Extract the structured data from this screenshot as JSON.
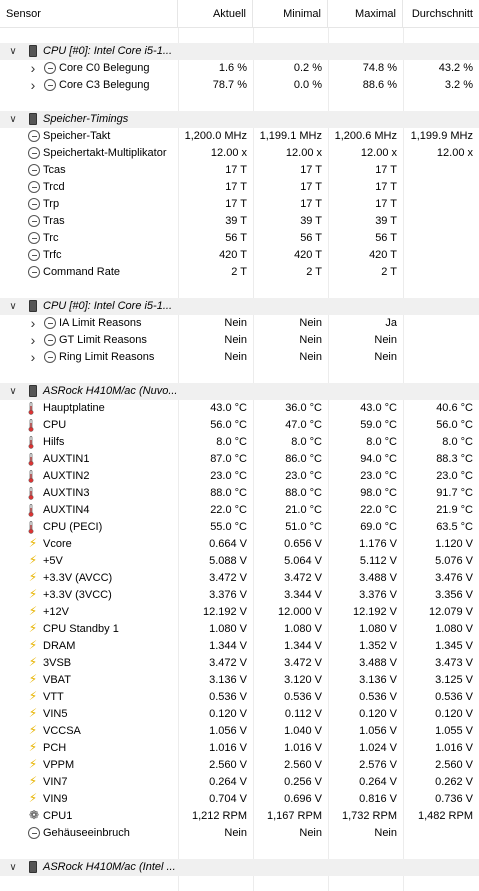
{
  "columns": {
    "sensor": "Sensor",
    "aktuell": "Aktuell",
    "minimal": "Minimal",
    "maximal": "Maximal",
    "durchschnitt": "Durchschnitt"
  },
  "groups": [
    {
      "label": "CPU [#0]: Intel Core i5-1...",
      "rows": [
        {
          "label": "Core C0 Belegung",
          "icon": "clock-icon",
          "expandable": true,
          "aktuell": "1.6 %",
          "minimal": "0.2 %",
          "maximal": "74.8 %",
          "durchschnitt": "43.2 %"
        },
        {
          "label": "Core C3 Belegung",
          "icon": "clock-icon",
          "expandable": true,
          "aktuell": "78.7 %",
          "minimal": "0.0 %",
          "maximal": "88.6 %",
          "durchschnitt": "3.2 %"
        }
      ]
    },
    {
      "label": "Speicher-Timings",
      "rows": [
        {
          "label": "Speicher-Takt",
          "icon": "clock-icon",
          "aktuell": "1,200.0 MHz",
          "minimal": "1,199.1 MHz",
          "maximal": "1,200.6 MHz",
          "durchschnitt": "1,199.9 MHz"
        },
        {
          "label": "Speichertakt-Multiplikator",
          "icon": "clock-icon",
          "aktuell": "12.00 x",
          "minimal": "12.00 x",
          "maximal": "12.00 x",
          "durchschnitt": "12.00 x"
        },
        {
          "label": "Tcas",
          "icon": "clock-icon",
          "aktuell": "17 T",
          "minimal": "17 T",
          "maximal": "17 T",
          "durchschnitt": ""
        },
        {
          "label": "Trcd",
          "icon": "clock-icon",
          "aktuell": "17 T",
          "minimal": "17 T",
          "maximal": "17 T",
          "durchschnitt": ""
        },
        {
          "label": "Trp",
          "icon": "clock-icon",
          "aktuell": "17 T",
          "minimal": "17 T",
          "maximal": "17 T",
          "durchschnitt": ""
        },
        {
          "label": "Tras",
          "icon": "clock-icon",
          "aktuell": "39 T",
          "minimal": "39 T",
          "maximal": "39 T",
          "durchschnitt": ""
        },
        {
          "label": "Trc",
          "icon": "clock-icon",
          "aktuell": "56 T",
          "minimal": "56 T",
          "maximal": "56 T",
          "durchschnitt": ""
        },
        {
          "label": "Trfc",
          "icon": "clock-icon",
          "aktuell": "420 T",
          "minimal": "420 T",
          "maximal": "420 T",
          "durchschnitt": ""
        },
        {
          "label": "Command Rate",
          "icon": "clock-icon",
          "aktuell": "2 T",
          "minimal": "2 T",
          "maximal": "2 T",
          "durchschnitt": ""
        }
      ]
    },
    {
      "label": "CPU [#0]: Intel Core i5-1...",
      "rows": [
        {
          "label": "IA Limit Reasons",
          "icon": "clock-icon",
          "expandable": true,
          "aktuell": "Nein",
          "minimal": "Nein",
          "maximal": "Ja",
          "durchschnitt": ""
        },
        {
          "label": "GT Limit Reasons",
          "icon": "clock-icon",
          "expandable": true,
          "aktuell": "Nein",
          "minimal": "Nein",
          "maximal": "Nein",
          "durchschnitt": ""
        },
        {
          "label": "Ring Limit Reasons",
          "icon": "clock-icon",
          "expandable": true,
          "aktuell": "Nein",
          "minimal": "Nein",
          "maximal": "Nein",
          "durchschnitt": ""
        }
      ]
    },
    {
      "label": "ASRock H410M/ac (Nuvo...",
      "rows": [
        {
          "label": "Hauptplatine",
          "icon": "thermometer-icon",
          "aktuell": "43.0 °C",
          "minimal": "36.0 °C",
          "maximal": "43.0 °C",
          "durchschnitt": "40.6 °C"
        },
        {
          "label": "CPU",
          "icon": "thermometer-icon",
          "aktuell": "56.0 °C",
          "minimal": "47.0 °C",
          "maximal": "59.0 °C",
          "durchschnitt": "56.0 °C"
        },
        {
          "label": "Hilfs",
          "icon": "thermometer-icon",
          "aktuell": "8.0 °C",
          "minimal": "8.0 °C",
          "maximal": "8.0 °C",
          "durchschnitt": "8.0 °C"
        },
        {
          "label": "AUXTIN1",
          "icon": "thermometer-icon",
          "aktuell": "87.0 °C",
          "minimal": "86.0 °C",
          "maximal": "94.0 °C",
          "durchschnitt": "88.3 °C"
        },
        {
          "label": "AUXTIN2",
          "icon": "thermometer-icon",
          "aktuell": "23.0 °C",
          "minimal": "23.0 °C",
          "maximal": "23.0 °C",
          "durchschnitt": "23.0 °C"
        },
        {
          "label": "AUXTIN3",
          "icon": "thermometer-icon",
          "aktuell": "88.0 °C",
          "minimal": "88.0 °C",
          "maximal": "98.0 °C",
          "durchschnitt": "91.7 °C"
        },
        {
          "label": "AUXTIN4",
          "icon": "thermometer-icon",
          "aktuell": "22.0 °C",
          "minimal": "21.0 °C",
          "maximal": "22.0 °C",
          "durchschnitt": "21.9 °C"
        },
        {
          "label": "CPU (PECI)",
          "icon": "thermometer-icon",
          "aktuell": "55.0 °C",
          "minimal": "51.0 °C",
          "maximal": "69.0 °C",
          "durchschnitt": "63.5 °C"
        },
        {
          "label": "Vcore",
          "icon": "voltage-bolt-icon",
          "aktuell": "0.664 V",
          "minimal": "0.656 V",
          "maximal": "1.176 V",
          "durchschnitt": "1.120 V"
        },
        {
          "label": "+5V",
          "icon": "voltage-bolt-icon",
          "aktuell": "5.088 V",
          "minimal": "5.064 V",
          "maximal": "5.112 V",
          "durchschnitt": "5.076 V"
        },
        {
          "label": "+3.3V (AVCC)",
          "icon": "voltage-bolt-icon",
          "aktuell": "3.472 V",
          "minimal": "3.472 V",
          "maximal": "3.488 V",
          "durchschnitt": "3.476 V"
        },
        {
          "label": "+3.3V (3VCC)",
          "icon": "voltage-bolt-icon",
          "aktuell": "3.376 V",
          "minimal": "3.344 V",
          "maximal": "3.376 V",
          "durchschnitt": "3.356 V"
        },
        {
          "label": "+12V",
          "icon": "voltage-bolt-icon",
          "aktuell": "12.192 V",
          "minimal": "12.000 V",
          "maximal": "12.192 V",
          "durchschnitt": "12.079 V"
        },
        {
          "label": "CPU Standby 1",
          "icon": "voltage-bolt-icon",
          "aktuell": "1.080 V",
          "minimal": "1.080 V",
          "maximal": "1.080 V",
          "durchschnitt": "1.080 V"
        },
        {
          "label": "DRAM",
          "icon": "voltage-bolt-icon",
          "aktuell": "1.344 V",
          "minimal": "1.344 V",
          "maximal": "1.352 V",
          "durchschnitt": "1.345 V"
        },
        {
          "label": "3VSB",
          "icon": "voltage-bolt-icon",
          "aktuell": "3.472 V",
          "minimal": "3.472 V",
          "maximal": "3.488 V",
          "durchschnitt": "3.473 V"
        },
        {
          "label": "VBAT",
          "icon": "voltage-bolt-icon",
          "aktuell": "3.136 V",
          "minimal": "3.120 V",
          "maximal": "3.136 V",
          "durchschnitt": "3.125 V"
        },
        {
          "label": "VTT",
          "icon": "voltage-bolt-icon",
          "aktuell": "0.536 V",
          "minimal": "0.536 V",
          "maximal": "0.536 V",
          "durchschnitt": "0.536 V"
        },
        {
          "label": "VIN5",
          "icon": "voltage-bolt-icon",
          "aktuell": "0.120 V",
          "minimal": "0.112 V",
          "maximal": "0.120 V",
          "durchschnitt": "0.120 V"
        },
        {
          "label": "VCCSA",
          "icon": "voltage-bolt-icon",
          "aktuell": "1.056 V",
          "minimal": "1.040 V",
          "maximal": "1.056 V",
          "durchschnitt": "1.055 V"
        },
        {
          "label": "PCH",
          "icon": "voltage-bolt-icon",
          "aktuell": "1.016 V",
          "minimal": "1.016 V",
          "maximal": "1.024 V",
          "durchschnitt": "1.016 V"
        },
        {
          "label": "VPPM",
          "icon": "voltage-bolt-icon",
          "aktuell": "2.560 V",
          "minimal": "2.560 V",
          "maximal": "2.576 V",
          "durchschnitt": "2.560 V"
        },
        {
          "label": "VIN7",
          "icon": "voltage-bolt-icon",
          "aktuell": "0.264 V",
          "minimal": "0.256 V",
          "maximal": "0.264 V",
          "durchschnitt": "0.262 V"
        },
        {
          "label": "VIN9",
          "icon": "voltage-bolt-icon",
          "aktuell": "0.704 V",
          "minimal": "0.696 V",
          "maximal": "0.816 V",
          "durchschnitt": "0.736 V"
        },
        {
          "label": "CPU1",
          "icon": "fan-icon",
          "aktuell": "1,212 RPM",
          "minimal": "1,167 RPM",
          "maximal": "1,732 RPM",
          "durchschnitt": "1,482 RPM"
        },
        {
          "label": "Gehäuseeinbruch",
          "icon": "clock-icon",
          "aktuell": "Nein",
          "minimal": "Nein",
          "maximal": "Nein",
          "durchschnitt": ""
        }
      ]
    },
    {
      "label": "ASRock H410M/ac (Intel ...",
      "rows": []
    }
  ]
}
